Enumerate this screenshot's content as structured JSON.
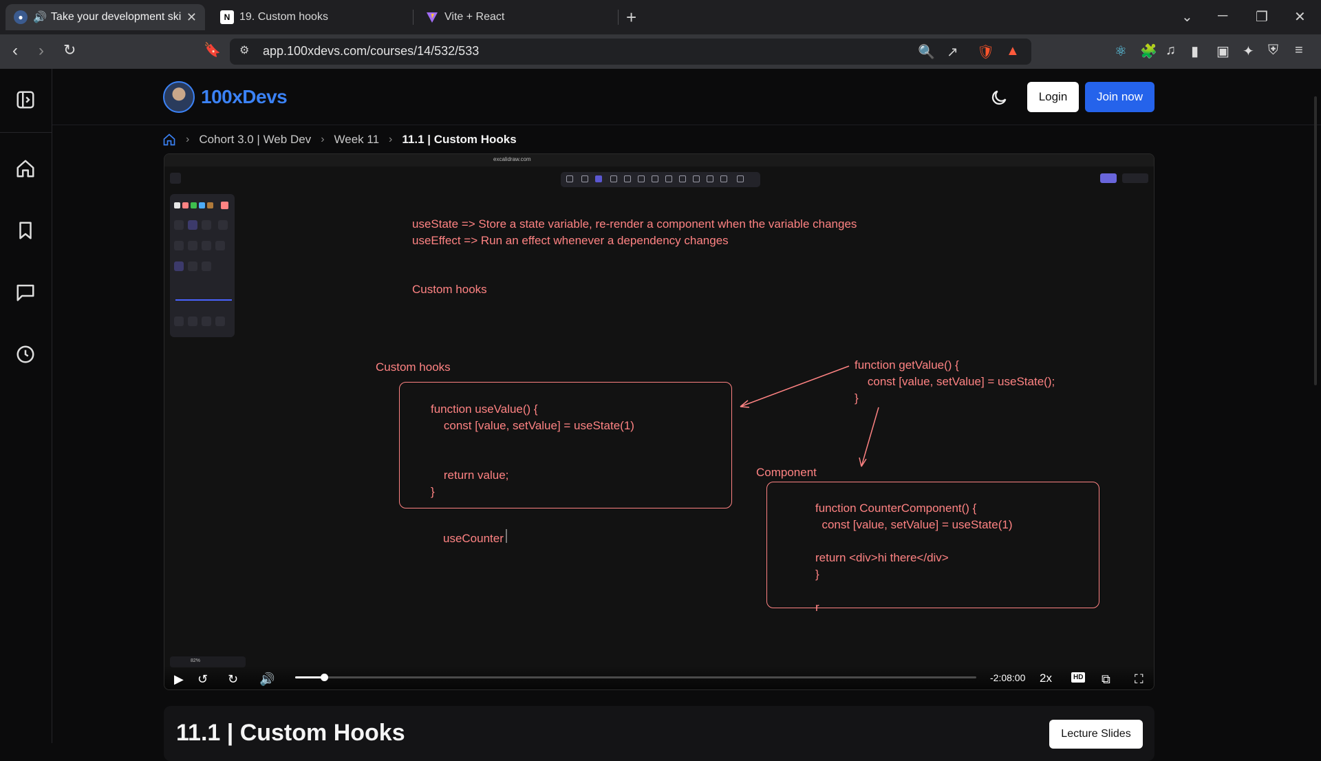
{
  "browser": {
    "tabs": [
      {
        "title": "Take your development skill",
        "active": true
      },
      {
        "title": "19. Custom hooks",
        "active": false
      },
      {
        "title": "Vite + React",
        "active": false
      }
    ],
    "url": "app.100xdevs.com/courses/14/532/533",
    "badge_brave": "1",
    "badge_alert": "1"
  },
  "site": {
    "brand": "100xDevs",
    "login_label": "Login",
    "join_label": "Join now"
  },
  "breadcrumb": {
    "items": [
      "Cohort 3.0 | Web Dev",
      "Week 11",
      "11.1 | Custom Hooks"
    ]
  },
  "video": {
    "drawing": {
      "line1": "useState => Store a state variable, re-render a component when the variable changes",
      "line2": "useEffect => Run an effect whenever a dependency changes",
      "heading1": "Custom hooks",
      "heading2": "Custom hooks",
      "box1": "function useValue() {\n    const [value, setValue] = useState(1)\n\n\n    return value;\n}",
      "use_counter": "useCounter",
      "get_value": "function getValue() {\n    const [value, setValue] = useState();\n}",
      "component_label": "Component",
      "box2": "function CounterComponent() {\n  const [value, setValue] = useState(1)\n\nreturn <div>hi there</div>\n}\n\nr"
    },
    "excalidraw_url": "excalidraw.com",
    "excalidraw_zoom": "82%",
    "time_remaining": "-2:08:00",
    "speed": "2x",
    "hd": "HD",
    "progress": 0.042,
    "accent_color": "#ff8383"
  },
  "lesson": {
    "title": "11.1 | Custom Hooks",
    "slides_label": "Lecture Slides"
  }
}
